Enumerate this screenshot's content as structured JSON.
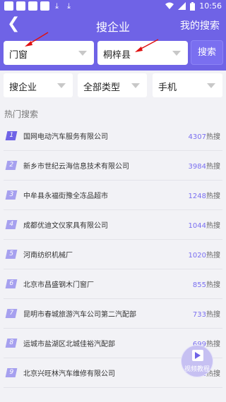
{
  "status": {
    "time": "10:56",
    "left_icons": [
      "app-square-icon",
      "app-square-icon",
      "app-square-icon",
      "app-square-icon",
      "download-icon",
      "download-icon"
    ],
    "right_icons": [
      "wifi-icon",
      "signal-icon",
      "battery-icon"
    ]
  },
  "header": {
    "title": "搜企业",
    "right_link": "我的搜索"
  },
  "search": {
    "keyword": "门窗",
    "region": "桐梓县",
    "button": "搜索"
  },
  "filters": [
    {
      "label": "搜企业"
    },
    {
      "label": "全部类型"
    },
    {
      "label": "手机"
    }
  ],
  "hot": {
    "title": "热门搜索",
    "unit": "热搜",
    "items": [
      {
        "rank": "1",
        "name": "国网电动汽车服务有限公司",
        "count": "4307"
      },
      {
        "rank": "2",
        "name": "新乡市世纪云海信息技术有限公司",
        "count": "3984"
      },
      {
        "rank": "3",
        "name": "中牟县永福街豫全冻品超市",
        "count": "1248"
      },
      {
        "rank": "4",
        "name": "成都优迪文仪家具有限公司",
        "count": "1044"
      },
      {
        "rank": "5",
        "name": "河南纺织机械厂",
        "count": "1020"
      },
      {
        "rank": "6",
        "name": "北京市昌盛钢木门窗厂",
        "count": "855"
      },
      {
        "rank": "7",
        "name": "昆明市春城旅游汽车公司第二汽配部",
        "count": "733"
      },
      {
        "rank": "8",
        "name": "运城市盐湖区北城佳裕汽配部",
        "count": "699"
      },
      {
        "rank": "9",
        "name": "北京兴旺林汽车维修有限公司",
        "count": "672"
      }
    ]
  },
  "fab": {
    "label": "视频教程"
  },
  "colors": {
    "accent": "#6f63e6",
    "arrow": "#e01010"
  }
}
